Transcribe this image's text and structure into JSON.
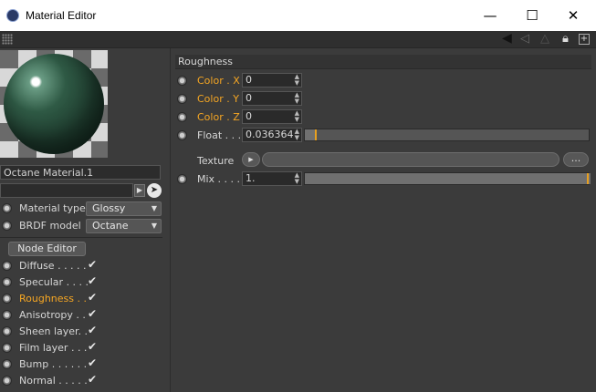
{
  "window": {
    "title": "Material Editor",
    "controls": {
      "minimize": "—",
      "maximize": "☐",
      "close": "✕"
    }
  },
  "left_panel": {
    "material_name": "Octane Material.1",
    "material_type_label": "Material type",
    "material_type_value": "Glossy",
    "brdf_label": "BRDF model",
    "brdf_value": "Octane",
    "node_editor_label": "Node Editor",
    "channels": [
      {
        "label": "Diffuse . . . . .",
        "checked": true,
        "active": false
      },
      {
        "label": "Specular . . . .",
        "checked": true,
        "active": false
      },
      {
        "label": "Roughness . .",
        "checked": true,
        "active": true
      },
      {
        "label": "Anisotropy . .",
        "checked": true,
        "active": false
      },
      {
        "label": "Sheen layer. .",
        "checked": true,
        "active": false
      },
      {
        "label": "Film layer . . .",
        "checked": true,
        "active": false
      },
      {
        "label": "Bump . . . . . .",
        "checked": true,
        "active": false
      },
      {
        "label": "Normal . . . . .",
        "checked": true,
        "active": false
      }
    ],
    "check_glyph": "✔"
  },
  "right_panel": {
    "section_title": "Roughness",
    "color_x_label": "Color . X",
    "color_x_value": "0",
    "color_y_label": "Color . Y",
    "color_y_value": "0",
    "color_z_label": "Color . Z",
    "color_z_value": "0",
    "float_label": "Float . . .",
    "float_value": "0.036364",
    "float_fraction": 0.036364,
    "texture_label": "Texture",
    "texture_more": "...",
    "mix_label": "Mix . . . .",
    "mix_value": "1.",
    "mix_fraction": 1.0
  },
  "colors": {
    "accent_orange": "#f5a623",
    "panel_bg": "#3b3b3b",
    "slider_marker": "#e8a020"
  }
}
